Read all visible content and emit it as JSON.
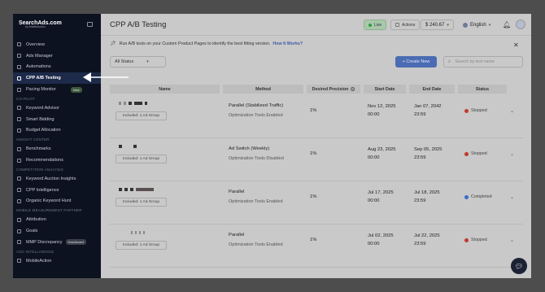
{
  "sidebar": {
    "brand": "SearchAds.com",
    "brand_sub": "by MobileAction",
    "items": [
      {
        "label": "Overview"
      },
      {
        "label": "Ads Manager"
      },
      {
        "label": "Automations"
      },
      {
        "label": "CPP A/B Testing"
      },
      {
        "label": "Pacing Monitor",
        "badge": "New"
      }
    ],
    "section_copilot": "CO-PILOT",
    "copilot_items": [
      {
        "label": "Keyword Advisor"
      },
      {
        "label": "Smart Bidding"
      },
      {
        "label": "Budget Allocation"
      }
    ],
    "section_insight": "INSIGHT CENTER",
    "insight_items": [
      {
        "label": "Benchmarks"
      },
      {
        "label": "Recommendations"
      }
    ],
    "section_competition": "COMPETITION ANALYSIS",
    "competition_items": [
      {
        "label": "Keyword Auction Insights"
      },
      {
        "label": "CPP Intelligence"
      },
      {
        "label": "Organic Keyword Hunt"
      }
    ],
    "section_mmp": "MOBILE MEASUREMENT PARTNER",
    "mmp_items": [
      {
        "label": "Attribution"
      },
      {
        "label": "Goals"
      },
      {
        "label": "MMP Discrepancy",
        "badge": "Dashboard"
      }
    ],
    "section_aso": "ASO INTELLIGENCE",
    "aso_items": [
      {
        "label": "MobileAction"
      }
    ]
  },
  "header": {
    "title": "CPP A/B Testing",
    "live": "Live",
    "actions": "Actions",
    "balance": "$ 240.67",
    "language": "English"
  },
  "info": {
    "text": "Run A/B tests on your Custom Product Pages to identify the best fitting version.",
    "link": "How It Works?"
  },
  "toolbar": {
    "status_filter": "All Status",
    "create_button": "+ Create New",
    "search_placeholder": "Search by test name"
  },
  "table": {
    "columns": [
      "Name",
      "Method",
      "Desired Precision",
      "Start Date",
      "End Date",
      "Status"
    ],
    "rows": [
      {
        "group": "Included: 1 Ad Group",
        "method": "Parallel (Stabilized Traffic)",
        "method_sub": "Optimization Tools Enabled",
        "precision": "1%",
        "start_date": "Nov 12, 2025",
        "start_time": "00:00",
        "end_date": "Jan 07, 2042",
        "end_time": "23:59",
        "status": "Stopped"
      },
      {
        "group": "Included: 1 Ad Group",
        "method": "Ad Switch (Weekly)",
        "method_sub": "Optimization Tools Disabled",
        "precision": "1%",
        "start_date": "Aug 23, 2025",
        "start_time": "00:00",
        "end_date": "Sep 05, 2025",
        "end_time": "23:59",
        "status": "Stopped"
      },
      {
        "group": "Included: 1 Ad Group",
        "method": "Parallel",
        "method_sub": "Optimization Tools Enabled",
        "precision": "1%",
        "start_date": "Jul 17, 2025",
        "start_time": "00:00",
        "end_date": "Jul 18, 2025",
        "end_time": "23:59",
        "status": "Completed"
      },
      {
        "group": "Included: 1 Ad Group",
        "method": "Parallel",
        "method_sub": "Optimization Tools Enabled",
        "precision": "1%",
        "start_date": "Jul 02, 2025",
        "start_time": "00:00",
        "end_date": "Jul 22, 2025",
        "end_time": "23:59",
        "status": "Stopped"
      }
    ]
  },
  "colors": {
    "sidebar_bg": "#0d1220",
    "accent": "#4b6bb3",
    "stopped": "#c0392b",
    "completed": "#3b6bc9",
    "live": "#2e9b44"
  }
}
